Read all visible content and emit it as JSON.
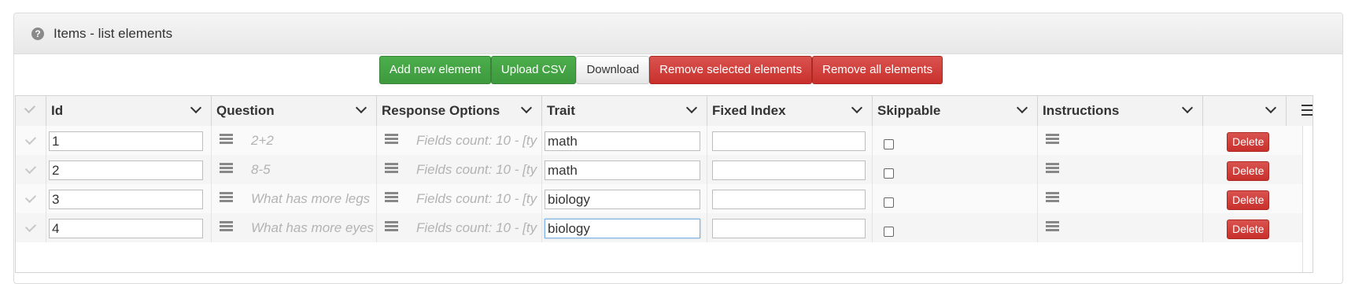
{
  "panel": {
    "help_icon": "?",
    "title": "Items - list elements"
  },
  "toolbar": {
    "add_label": "Add new element",
    "upload_label": "Upload CSV",
    "download_label": "Download",
    "remove_selected_label": "Remove selected elements",
    "remove_all_label": "Remove all elements"
  },
  "columns": {
    "id": "Id",
    "question": "Question",
    "response_options": "Response Options",
    "trait": "Trait",
    "fixed_index": "Fixed Index",
    "skippable": "Skippable",
    "instructions": "Instructions"
  },
  "rows": [
    {
      "id": "1",
      "question": "2+2",
      "response_options": "Fields count: 10 - [ty",
      "trait": "math",
      "fixed_index": "",
      "skippable": false,
      "delete_label": "Delete"
    },
    {
      "id": "2",
      "question": "8-5",
      "response_options": "Fields count: 10 - [ty",
      "trait": "math",
      "fixed_index": "",
      "skippable": false,
      "delete_label": "Delete"
    },
    {
      "id": "3",
      "question": "What has more legs",
      "response_options": "Fields count: 10 - [ty",
      "trait": "biology",
      "fixed_index": "",
      "skippable": false,
      "delete_label": "Delete"
    },
    {
      "id": "4",
      "question": "What has more eyes",
      "response_options": "Fields count: 10 - [ty",
      "trait": "biology",
      "fixed_index": "",
      "skippable": false,
      "delete_label": "Delete"
    }
  ],
  "colors": {
    "success": "#449d44",
    "danger": "#d9534f",
    "header_bg": "#f3f3f3"
  },
  "icons": [
    "help-icon",
    "chevron-down-icon",
    "menu-icon",
    "check-icon",
    "lines-icon"
  ]
}
